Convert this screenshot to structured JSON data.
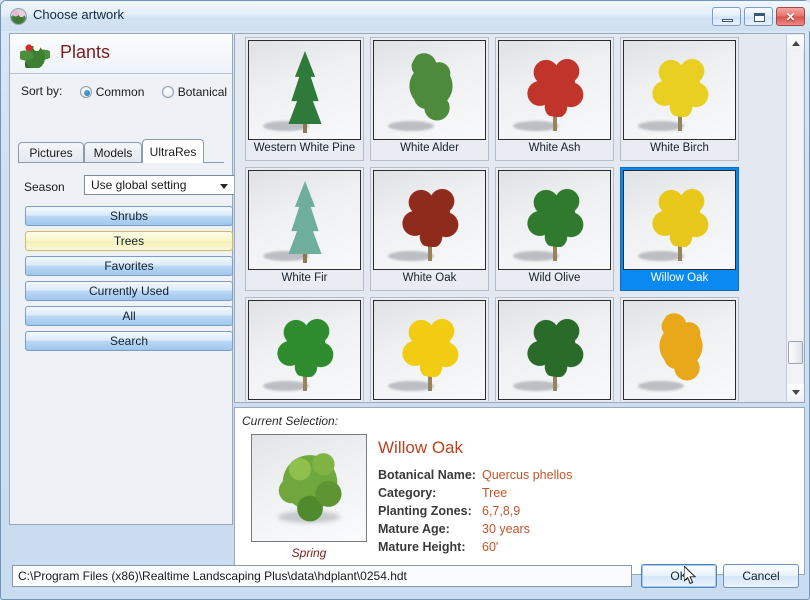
{
  "window": {
    "title": "Choose artwork",
    "icon": "flower-icon",
    "controls": {
      "minimize": "minimize-icon",
      "maximize": "maximize-icon",
      "close": "close-icon"
    }
  },
  "sidebar": {
    "header_title": "Plants",
    "header_icon": "plant-leaves-icon",
    "sort_by_label": "Sort by:",
    "sort_options": [
      {
        "label": "Common",
        "selected": true
      },
      {
        "label": "Botanical",
        "selected": false
      }
    ],
    "tabs": [
      {
        "label": "Pictures",
        "active": false
      },
      {
        "label": "Models",
        "active": false
      },
      {
        "label": "UltraRes",
        "active": true
      }
    ],
    "season_label": "Season",
    "season_value": "Use global setting",
    "category_buttons": [
      {
        "label": "Shrubs",
        "selected": false
      },
      {
        "label": "Trees",
        "selected": true
      },
      {
        "label": "Favorites",
        "selected": false
      },
      {
        "label": "Currently Used",
        "selected": false
      },
      {
        "label": "All",
        "selected": false
      },
      {
        "label": "Search",
        "selected": false
      }
    ]
  },
  "grid": {
    "items": [
      {
        "label": "Western White Pine",
        "selected": false,
        "form": "conifer",
        "color": "#2f7a3a"
      },
      {
        "label": "White Alder",
        "selected": false,
        "form": "broadleaf-tall",
        "color": "#4d8a3c"
      },
      {
        "label": "White Ash",
        "selected": false,
        "form": "broadleaf-round",
        "color": "#c0342b"
      },
      {
        "label": "White Birch",
        "selected": false,
        "form": "broadleaf-round",
        "color": "#e8cf22"
      },
      {
        "label": "White Fir",
        "selected": false,
        "form": "conifer",
        "color": "#6fae9a"
      },
      {
        "label": "White Oak",
        "selected": false,
        "form": "broadleaf-round",
        "color": "#8e2b1c"
      },
      {
        "label": "Wild Olive",
        "selected": false,
        "form": "broadleaf-round",
        "color": "#2f7a2c"
      },
      {
        "label": "Willow Oak",
        "selected": true,
        "form": "broadleaf-round",
        "color": "#e8c81a"
      },
      {
        "label": "",
        "selected": false,
        "form": "broadleaf-round",
        "color": "#2e8b2e"
      },
      {
        "label": "",
        "selected": false,
        "form": "broadleaf-round",
        "color": "#f2cc12"
      },
      {
        "label": "",
        "selected": false,
        "form": "broadleaf-round",
        "color": "#2a6b2a"
      },
      {
        "label": "",
        "selected": false,
        "form": "broadleaf-tall",
        "color": "#e8a81a"
      }
    ],
    "scrollbar": {
      "up_icon": "scroll-up-icon",
      "down_icon": "scroll-down-icon"
    }
  },
  "details": {
    "current_selection_label": "Current Selection:",
    "preview_caption": "Spring",
    "title": "Willow Oak",
    "fields": [
      {
        "key": "Botanical Name:",
        "value": "Quercus phellos"
      },
      {
        "key": "Category:",
        "value": "Tree"
      },
      {
        "key": "Planting Zones:",
        "value": "6,7,8,9"
      },
      {
        "key": "Mature Age:",
        "value": "30 years"
      },
      {
        "key": "Mature Height:",
        "value": "60'"
      }
    ]
  },
  "footer": {
    "path": "C:\\Program Files (x86)\\Realtime Landscaping Plus\\data\\hdplant\\0254.hdt",
    "ok_label": "OK",
    "cancel_label": "Cancel"
  },
  "colors": {
    "selection_blue": "#0a8af0",
    "accent_red": "#b8441f",
    "value_orange": "#c0562a",
    "highlight_yellow": "#f8f5c8"
  }
}
